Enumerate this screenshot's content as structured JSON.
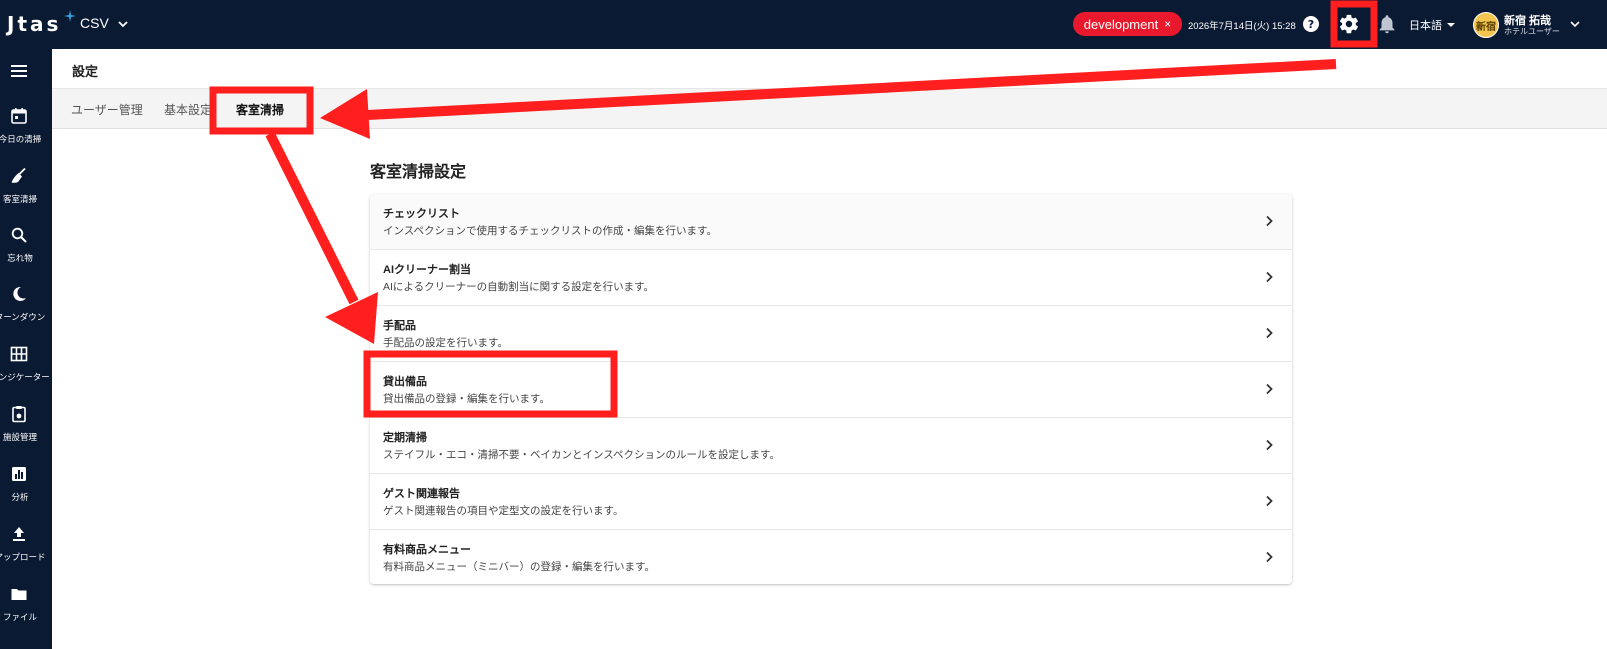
{
  "app": {
    "logo": "Jtas",
    "product": "CSV",
    "environment": "development",
    "environment_close": "×",
    "datetime": "2026年7月14日(火) 15:28",
    "language": "日本語",
    "user": {
      "avatar_text": "新宿",
      "name": "新宿 拓哉",
      "role": "ホテルユーザー"
    }
  },
  "sidebar": {
    "items": [
      {
        "icon": "calendar-icon",
        "label": "今日の清掃"
      },
      {
        "icon": "broom-icon",
        "label": "客室清掃"
      },
      {
        "icon": "search-icon",
        "label": "忘れ物"
      },
      {
        "icon": "moon-icon",
        "label": "ターンダウン"
      },
      {
        "icon": "grid-icon",
        "label": "インジケーター"
      },
      {
        "icon": "clipboard-icon",
        "label": "施設管理"
      },
      {
        "icon": "chart-icon",
        "label": "分析"
      },
      {
        "icon": "upload-icon",
        "label": "アップロード"
      },
      {
        "icon": "folder-icon",
        "label": "ファイル"
      }
    ]
  },
  "page": {
    "title": "設定",
    "tabs": [
      {
        "label": "ユーザー管理",
        "active": false
      },
      {
        "label": "基本設定",
        "active": false
      },
      {
        "label": "客室清掃",
        "active": true
      }
    ]
  },
  "section": {
    "title": "客室清掃設定",
    "rows": [
      {
        "title": "チェックリスト",
        "description": "インスペクションで使用するチェックリストの作成・編集を行います。"
      },
      {
        "title": "AIクリーナー割当",
        "description": "AIによるクリーナーの自動割当に関する設定を行います。"
      },
      {
        "title": "手配品",
        "description": "手配品の設定を行います。"
      },
      {
        "title": "貸出備品",
        "description": "貸出備品の登録・編集を行います。"
      },
      {
        "title": "定期清掃",
        "description": "ステイフル・エコ・清掃不要・ベイカンとインスペクションのルールを設定します。"
      },
      {
        "title": "ゲスト関連報告",
        "description": "ゲスト関連報告の項目や定型文の設定を行います。"
      },
      {
        "title": "有料商品メニュー",
        "description": "有料商品メニュー（ミニバー）の登録・編集を行います。"
      }
    ]
  },
  "colors": {
    "topbar": "#0b1a33",
    "env_chip": "#e8192c",
    "annotation": "#ff1f1f"
  }
}
